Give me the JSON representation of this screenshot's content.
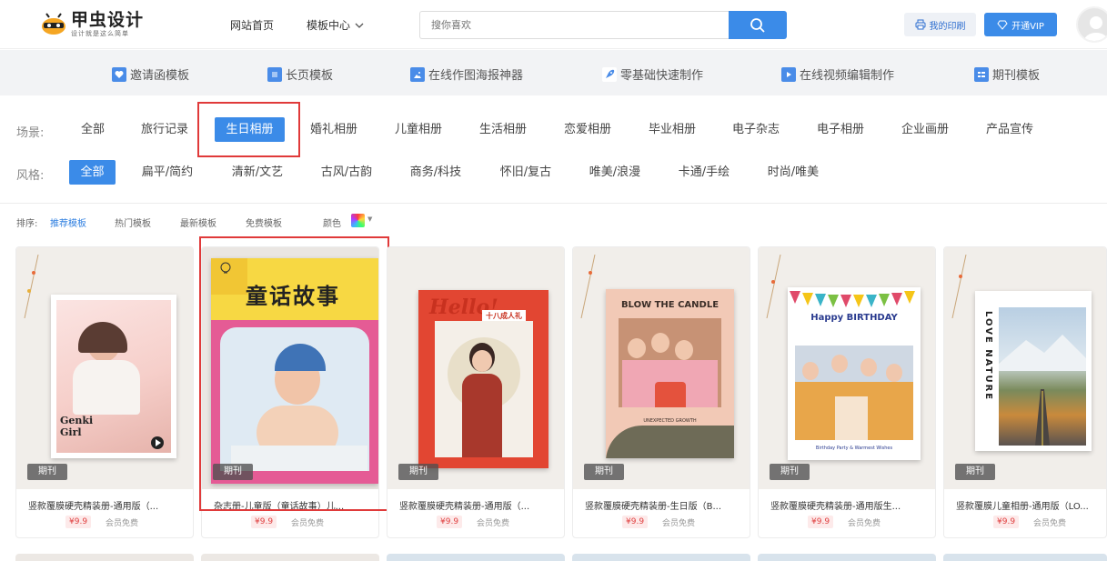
{
  "header": {
    "logo_main": "甲虫设计",
    "logo_sub": "设计就是这么简单",
    "nav_home": "网站首页",
    "nav_templates": "模板中心",
    "search_placeholder": "搜你喜欢",
    "print_label": "我的印刷",
    "vip_label": "开通VIP"
  },
  "categories": [
    {
      "label": "邀请函模板",
      "icon": "invitation-icon"
    },
    {
      "label": "长页模板",
      "icon": "long-page-icon"
    },
    {
      "label": "在线作图海报神器",
      "icon": "image-icon"
    },
    {
      "label": "零基础快速制作",
      "icon": "rocket-icon"
    },
    {
      "label": "在线视频编辑制作",
      "icon": "video-icon"
    },
    {
      "label": "期刊模板",
      "icon": "magazine-icon"
    }
  ],
  "scene": {
    "label": "场景:",
    "items": [
      "全部",
      "旅行记录",
      "生日相册",
      "婚礼相册",
      "儿童相册",
      "生活相册",
      "恋爱相册",
      "毕业相册",
      "电子杂志",
      "电子相册",
      "企业画册",
      "产品宣传"
    ],
    "active": "生日相册"
  },
  "style": {
    "label": "风格:",
    "items": [
      "全部",
      "扁平/简约",
      "清新/文艺",
      "古风/古韵",
      "商务/科技",
      "怀旧/复古",
      "唯美/浪漫",
      "卡通/手绘",
      "时尚/唯美"
    ],
    "active": "全部"
  },
  "sort": {
    "label": "排序:",
    "items": [
      "推荐模板",
      "热门模板",
      "最新模板",
      "免费模板"
    ],
    "active": "推荐模板",
    "color_label": "颜色"
  },
  "cards": [
    {
      "tag": "期刊",
      "title": "竖款覆膜硬壳精装册-通用版（...",
      "price": "¥9.9",
      "free": "会员免费",
      "cover_text": "Genki Girl"
    },
    {
      "tag": "期刊",
      "title": "杂志册-儿童版（童话故事）儿...",
      "price": "¥9.9",
      "free": "会员免费",
      "cover_text": "童话故事"
    },
    {
      "tag": "期刊",
      "title": "竖款覆膜硬壳精装册-通用版（...",
      "price": "¥9.9",
      "free": "会员免费",
      "cover_text": "Hello!",
      "cover_badge": "十八成人礼"
    },
    {
      "tag": "期刊",
      "title": "竖款覆膜硬壳精装册-生日版（B...",
      "price": "¥9.9",
      "free": "会员免费",
      "cover_text": "BLOW THE CANDLE",
      "cover_sub": "UNEXPECTED GROWTH"
    },
    {
      "tag": "期刊",
      "title": "竖款覆膜硬壳精装册-通用版生...",
      "price": "¥9.9",
      "free": "会员免费",
      "cover_text": "Happy BIRTHDAY",
      "cover_sub": "Birthday Party & Warmest Wishes"
    },
    {
      "tag": "期刊",
      "title": "竖款覆膜儿童相册-通用版（LO...",
      "price": "¥9.9",
      "free": "会员免费",
      "cover_text": "LOVE NATURE"
    }
  ]
}
